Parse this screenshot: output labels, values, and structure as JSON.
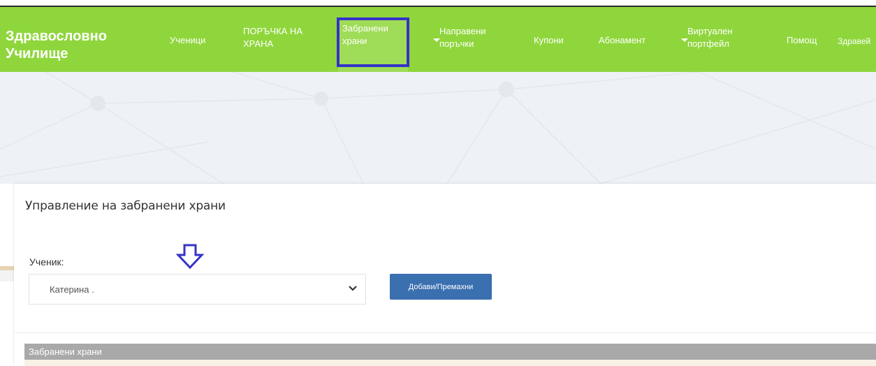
{
  "brand": {
    "line1": "Здравословно",
    "line2": "Училище"
  },
  "nav": {
    "students": "Ученици",
    "food_order_1": "ПОРЪЧКА НА",
    "food_order_2": "ХРАНА",
    "forbidden_1": "Забранени",
    "forbidden_2": "храни",
    "orders_1": "Направени",
    "orders_2": "поръчки",
    "coupons": "Купони",
    "subscription": "Абонамент",
    "portfolio_1": "Виртуален",
    "portfolio_2": "портфейл",
    "help": "Помощ",
    "greeting": "Здравей"
  },
  "page": {
    "title": "Управление на забранени храни",
    "student_label": "Ученик:",
    "student_selected": "Катерина .",
    "add_remove_button": "Добави/Премахни",
    "table_header": "Забранени храни"
  },
  "colors": {
    "navbar": "#8fd63c",
    "highlight": "#3533c8",
    "button": "#3a6fb0",
    "table_header": "#a9a9a9"
  }
}
